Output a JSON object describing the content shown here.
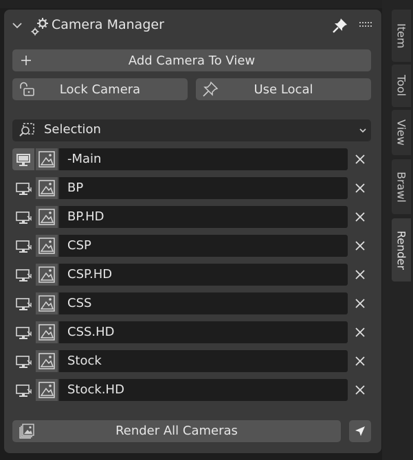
{
  "panel": {
    "title": "Camera Manager",
    "add_camera_label": "Add Camera To View",
    "lock_camera_label": "Lock Camera",
    "use_local_label": "Use Local",
    "selection_label": "Selection",
    "render_all_label": "Render All Cameras"
  },
  "cameras": [
    {
      "name": "-Main",
      "active": true
    },
    {
      "name": "BP",
      "active": false
    },
    {
      "name": "BP.HD",
      "active": false
    },
    {
      "name": "CSP",
      "active": false
    },
    {
      "name": "CSP.HD",
      "active": false
    },
    {
      "name": "CSS",
      "active": false
    },
    {
      "name": "CSS.HD",
      "active": false
    },
    {
      "name": "Stock",
      "active": false
    },
    {
      "name": "Stock.HD",
      "active": false
    }
  ],
  "sidebar_tabs": [
    {
      "label": "Item",
      "active": false
    },
    {
      "label": "Tool",
      "active": false
    },
    {
      "label": "View",
      "active": false
    },
    {
      "label": "Brawl",
      "active": false
    },
    {
      "label": "Render",
      "active": true
    }
  ],
  "icons": {
    "collapse": "chevron-down-icon",
    "header": "gear-icon",
    "pin": "pin-icon",
    "grip": "drag-handle-icon",
    "add": "plus-icon",
    "lock": "unlocked-icon",
    "local": "pin-outline-icon",
    "selection": "selection-box-icon",
    "view": "monitor-icon",
    "render": "image-icon",
    "remove": "close-icon",
    "render_all": "images-icon",
    "select": "cursor-icon"
  }
}
